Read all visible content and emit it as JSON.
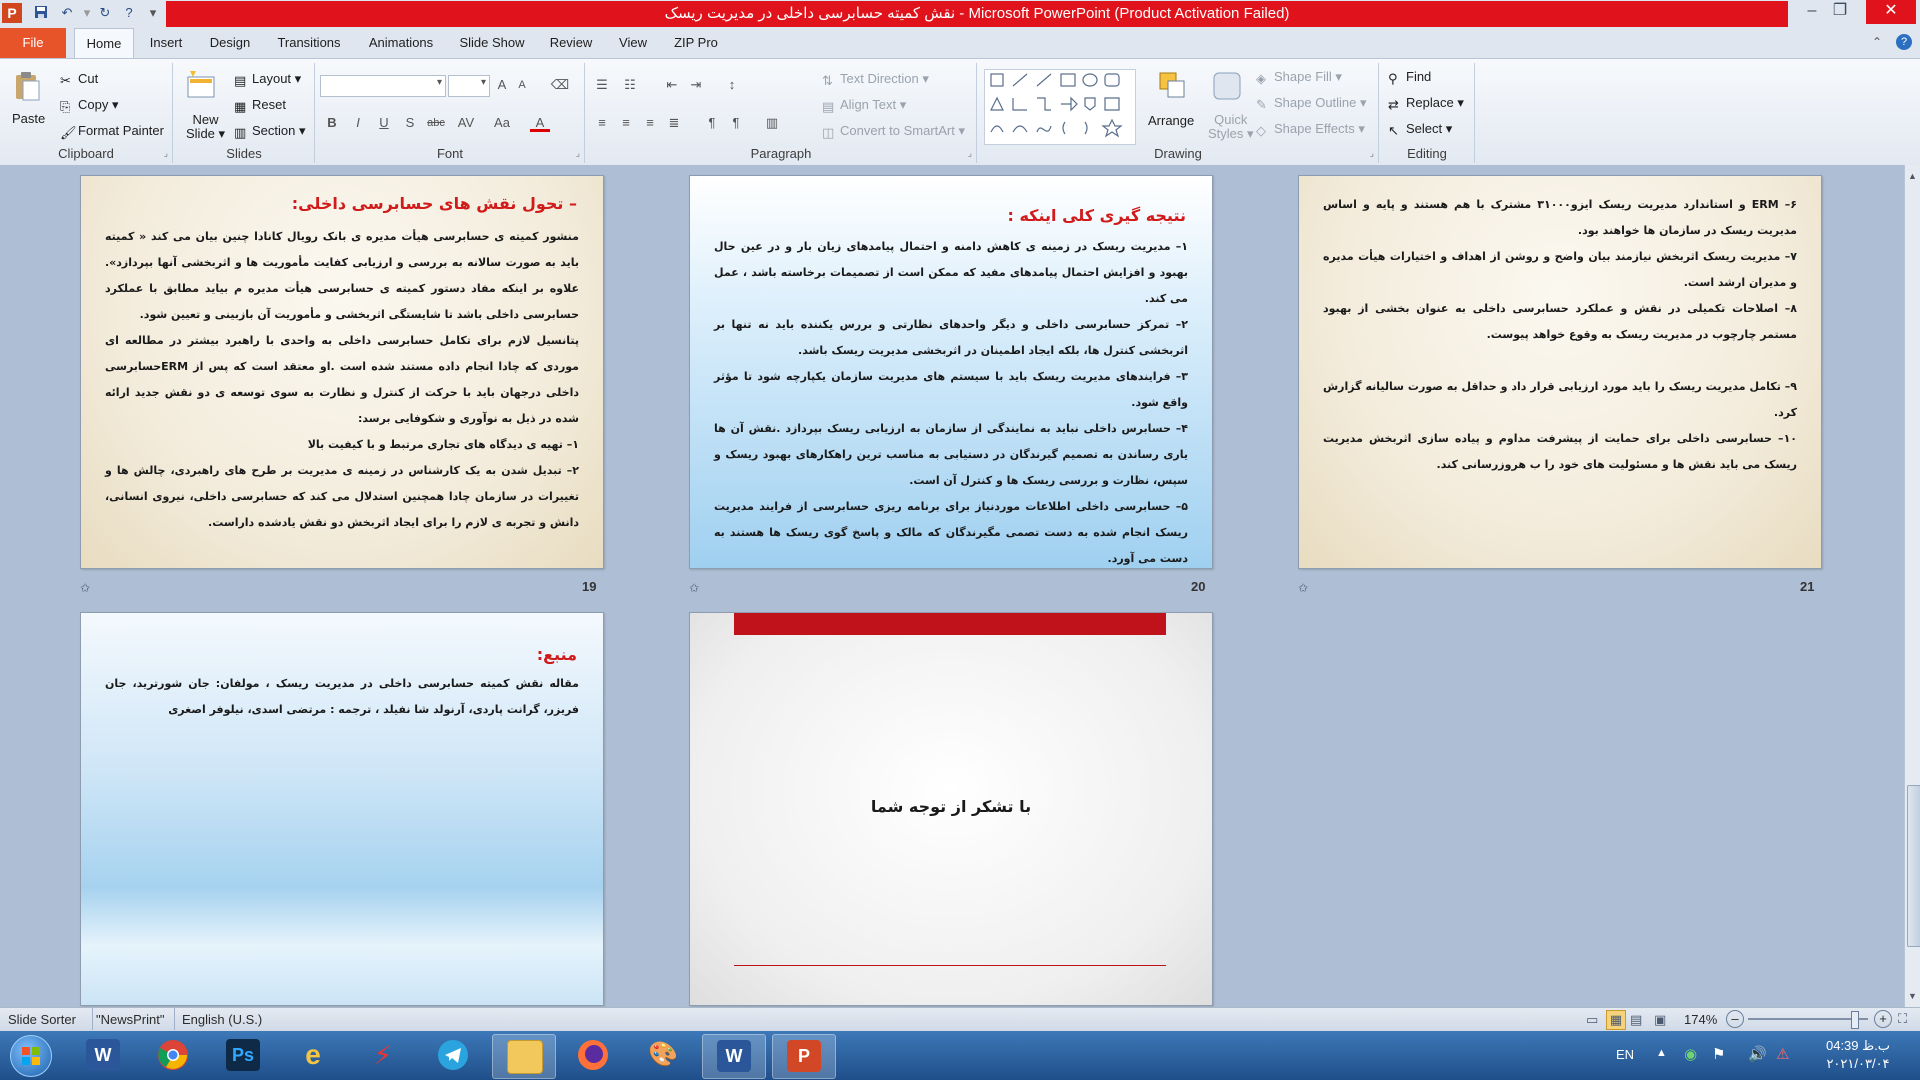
{
  "window": {
    "title": "نقش کمیته حسابرسی داخلی در مدیریت ریسک - Microsoft PowerPoint (Product Activation Failed)",
    "app_badge": "P",
    "controls": {
      "minimize": "–",
      "maximize": "❐",
      "close": "✕"
    }
  },
  "tabs": [
    "File",
    "Home",
    "Insert",
    "Design",
    "Transitions",
    "Animations",
    "Slide Show",
    "Review",
    "View",
    "ZIP Pro"
  ],
  "ribbon": {
    "clipboard": {
      "label": "Clipboard",
      "paste": "Paste",
      "cut": "Cut",
      "copy": "Copy",
      "format_painter": "Format Painter"
    },
    "slides": {
      "label": "Slides",
      "new_slide_1": "New",
      "new_slide_2": "Slide",
      "layout": "Layout",
      "reset": "Reset",
      "section": "Section"
    },
    "font": {
      "label": "Font",
      "bold": "B",
      "italic": "I",
      "underline": "U",
      "strike": "S",
      "spacing": "abc",
      "change_case": "Aa",
      "grow": "A",
      "shrink": "A",
      "color": "A"
    },
    "paragraph": {
      "label": "Paragraph",
      "text_direction": "Text Direction",
      "align_text": "Align Text",
      "convert_smartart": "Convert to SmartArt"
    },
    "drawing": {
      "label": "Drawing",
      "arrange": "Arrange",
      "quick_styles_1": "Quick",
      "quick_styles_2": "Styles",
      "shape_fill": "Shape Fill",
      "shape_outline": "Shape Outline",
      "shape_effects": "Shape Effects"
    },
    "editing": {
      "label": "Editing",
      "find": "Find",
      "replace": "Replace",
      "select": "Select"
    }
  },
  "slides": [
    {
      "number": "19",
      "title": "– تحول نقش های حسابرسی داخلی:",
      "body": [
        "منشور کمیته ی حسابرسی هیأت مدیره ی بانک رویال کانادا چنین بیان می کند « کمیته باید به صورت سالانه به بررسی و ارزیابی کفایت مأموریت ها و اثربخشی آنها بپردازد». علاوه بر اینکه مفاد دستور کمیته ی حسابرسی هیأت مدیره م بیاید مطابق با عملکرد حسابرسی داخلی باشد تا شایستگی اثربخشی و مأموریت آن بازبینی و تعیین شود.",
        "پتانسیل لازم برای تکامل حسابرسی داخلی به واحدی با راهبرد بیشتر در مطالعه ای موردی که چادا انجام داده مستند شده است .او معتقد است که پس از ERMحسابرسی داخلی درجهان باید با حرکت از کنترل و نظارت به سوی توسعه ی دو نقش جدید ارائه شده در ذیل به نوآوری و شکوفایی برسد:",
        "۱– تهیه ی دیدگاه های تجاری مرتبط و با کیفیت بالا",
        "۲– تبدیل شدن به یک کارشناس در زمینه ی مدیریت بر طرح های راهبردی، چالش ها و تغییرات در سازمان چادا همچنین استدلال می کند که حسابرسی داخلی، نیروی انسانی، دانش و تجربه ی لازم را برای ایجاد اثربخش دو نقش یادشده داراست."
      ]
    },
    {
      "number": "20",
      "title": "نتیجه گیری کلی اینکه :",
      "body": [
        "۱– مدیریت ریسک در زمینه ی کاهش دامنه و احتمال پیامدهای زیان بار و در عین حال بهبود و افزایش احتمال پیامدهای مفید که ممکن است از تصمیمات برخاسته باشد ، عمل می کند.",
        "۲– تمرکز حسابرسی داخلی و دیگر واحدهای نظارتی و بررس یکننده باید نه تنها بر اثربخشی کنترل ها، بلکه ایجاد اطمینان در اثربخشی مدیریت ریسک باشد.",
        "۳– فرایندهای مدیریت ریسک باید با سیستم های مدیریت سازمان یکپارچه شود تا مؤثر واقع شود.",
        "۴– حسابرس داخلی نباید به نمایندگی از سازمان به ارزیابی ریسک بپردازد .نقش آن ها یاری رساندن به تصمیم گیرندگان در دستیابی به مناسب ترین راهکارهای بهبود ریسک و سپس، نظارت و بررسی ریسک ها و کنترل آن است.",
        "۵– حسابرسی داخلی اطلاعات موردنیاز برای برنامه ریزی حسابرسی از فرایند مدیریت ریسک انجام شده به دست تصمی مگیرندگان که مالک و پاسخ گوی ریسک ها هستند به دست می آورد."
      ]
    },
    {
      "number": "21",
      "title": "",
      "body": [
        "۶– ERM و استاندارد مدیریت ریسک ایزو۳۱۰۰۰ مشترک با هم هستند و پایه و اساس مدیریت ریسک در سازمان ها خواهند بود.",
        "۷– مدیریت ریسک اثربخش نیازمند بیان واضح و روشن از اهداف و اختیارات هیأت مدیره و مدیران ارشد است.",
        "۸– اصلاحات تکمیلی در نقش و عملکرد حسابرسی داخلی به عنوان بخشی از بهبود مستمر چارچوب در مدیریت ریسک به وقوع خواهد پیوست.",
        "",
        "۹– تکامل مدیریت ریسک را باید مورد ارزیابی قرار داد و حداقل به صورت سالیانه گزارش کرد.",
        "۱۰– حسابرسی داخلی برای حمایت از پیشرفت مداوم و پیاده سازی اثربخش مدیریت ریسک می باید نقش ها و مسئولیت های خود را ب هروزرسانی کند."
      ]
    },
    {
      "number": "",
      "title": "منبع:",
      "body": [
        "مقاله نقش کمیته حسابرسی داخلی در مدیریت ریسک ، مولفان: جان شورترید، جان فریزر، گرانت پاردی، آرنولد شا نفیلد ، ترجمه : مرتضی اسدی، نیلوفر اصغری"
      ]
    },
    {
      "number": "",
      "title": "",
      "body": [
        "با تشکر از توجه شما"
      ]
    }
  ],
  "statusbar": {
    "view": "Slide Sorter",
    "theme": "\"NewsPrint\"",
    "language": "English (U.S.)",
    "zoom": "174%",
    "zoom_level": 0.9
  },
  "taskbar": {
    "apps": [
      "start",
      "word",
      "chrome",
      "photoshop",
      "ie",
      "flash",
      "telegram",
      "explorer",
      "firefox",
      "paint",
      "word-active",
      "powerpoint-active"
    ],
    "lang": "EN",
    "time": "04:39 ب.ظ",
    "date": "۲۰۲۱/۰۳/۰۴"
  }
}
